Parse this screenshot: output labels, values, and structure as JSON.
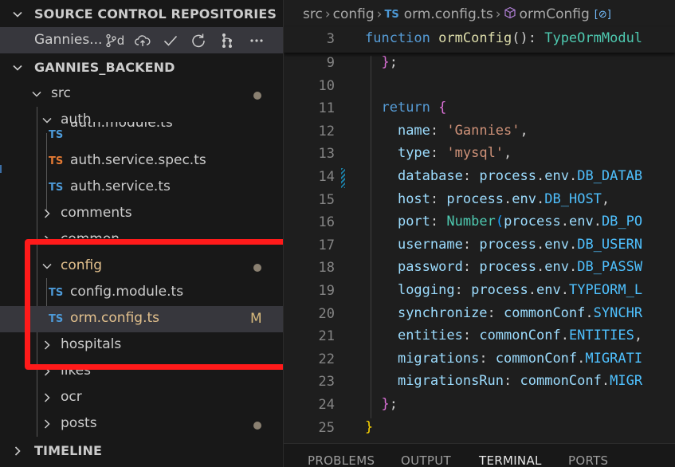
{
  "sidebar": {
    "source_control_header": "SOURCE CONTROL REPOSITORIES",
    "repo": {
      "name": "Gannies...",
      "branch_label": "d",
      "icons": [
        "git-branch-icon",
        "cloud-upload-icon",
        "check-icon",
        "refresh-icon",
        "graph-icon",
        "more-icon"
      ]
    },
    "explorer_header": "GANNIES_BACKEND",
    "tree": [
      {
        "label": "src",
        "kind": "folder",
        "expanded": true,
        "modified_dot": true
      },
      {
        "label": "auth",
        "kind": "folder",
        "expanded": true
      },
      {
        "label": "auth.module.ts",
        "kind": "file",
        "ts_color": "#4d9ad8"
      },
      {
        "label": "auth.service.spec.ts",
        "kind": "file",
        "ts_color": "#e37933"
      },
      {
        "label": "auth.service.ts",
        "kind": "file",
        "ts_color": "#4d9ad8"
      },
      {
        "label": "comments",
        "kind": "folder",
        "expanded": false
      },
      {
        "label": "common",
        "kind": "folder",
        "expanded": false
      },
      {
        "label": "config",
        "kind": "folder",
        "expanded": true,
        "modified_dot": true,
        "color": "#e2c08d"
      },
      {
        "label": "config.module.ts",
        "kind": "file",
        "ts_color": "#4d9ad8"
      },
      {
        "label": "orm.config.ts",
        "kind": "file",
        "ts_color": "#4d9ad8",
        "badge": "M",
        "selected": true,
        "color": "#e2c08d"
      },
      {
        "label": "hospitals",
        "kind": "folder",
        "expanded": false
      },
      {
        "label": "likes",
        "kind": "folder",
        "expanded": false
      },
      {
        "label": "ocr",
        "kind": "folder",
        "expanded": false
      },
      {
        "label": "posts",
        "kind": "folder",
        "expanded": false,
        "modified_dot": true
      }
    ],
    "ts_label": "TS",
    "timeline_header": "TIMELINE",
    "highlight_color": "#ff1a1a"
  },
  "editor": {
    "breadcrumb": {
      "segments": [
        "src",
        "config",
        "orm.config.ts",
        "ormConfig"
      ],
      "ts_label": "TS"
    },
    "sticky_line": {
      "number": "3",
      "kw": "function",
      "fn": "ormConfig",
      "after": "(): ",
      "type": "TypeOrmModul"
    },
    "lines": [
      {
        "n": "9",
        "tokens": [
          [
            "pu",
            "  "
          ],
          [
            "br2",
            "}"
          ],
          [
            "pu",
            ";"
          ]
        ]
      },
      {
        "n": "10",
        "tokens": []
      },
      {
        "n": "11",
        "tokens": [
          [
            "pu",
            "  "
          ],
          [
            "kw",
            "return"
          ],
          [
            "pu",
            " "
          ],
          [
            "br2",
            "{"
          ]
        ]
      },
      {
        "n": "12",
        "tokens": [
          [
            "pu",
            "    "
          ],
          [
            "pr",
            "name"
          ],
          [
            "pu",
            ": "
          ],
          [
            "st",
            "'Gannies'"
          ],
          [
            "pu",
            ","
          ]
        ]
      },
      {
        "n": "13",
        "tokens": [
          [
            "pu",
            "    "
          ],
          [
            "pr",
            "type"
          ],
          [
            "pu",
            ": "
          ],
          [
            "st",
            "'mysql'"
          ],
          [
            "pu",
            ","
          ]
        ]
      },
      {
        "n": "14",
        "tokens": [
          [
            "pu",
            "    "
          ],
          [
            "pr",
            "database"
          ],
          [
            "pu",
            ": "
          ],
          [
            "pr",
            "process"
          ],
          [
            "pu",
            "."
          ],
          [
            "pr",
            "env"
          ],
          [
            "pu",
            "."
          ],
          [
            "cn",
            "DB_DATAB"
          ]
        ]
      },
      {
        "n": "15",
        "tokens": [
          [
            "pu",
            "    "
          ],
          [
            "pr",
            "host"
          ],
          [
            "pu",
            ": "
          ],
          [
            "pr",
            "process"
          ],
          [
            "pu",
            "."
          ],
          [
            "pr",
            "env"
          ],
          [
            "pu",
            "."
          ],
          [
            "cn",
            "DB_HOST"
          ],
          [
            "pu",
            ","
          ]
        ]
      },
      {
        "n": "16",
        "tokens": [
          [
            "pu",
            "    "
          ],
          [
            "pr",
            "port"
          ],
          [
            "pu",
            ": "
          ],
          [
            "ty",
            "Number"
          ],
          [
            "br3",
            "("
          ],
          [
            "pr",
            "process"
          ],
          [
            "pu",
            "."
          ],
          [
            "pr",
            "env"
          ],
          [
            "pu",
            "."
          ],
          [
            "cn",
            "DB_PO"
          ]
        ]
      },
      {
        "n": "17",
        "tokens": [
          [
            "pu",
            "    "
          ],
          [
            "pr",
            "username"
          ],
          [
            "pu",
            ": "
          ],
          [
            "pr",
            "process"
          ],
          [
            "pu",
            "."
          ],
          [
            "pr",
            "env"
          ],
          [
            "pu",
            "."
          ],
          [
            "cn",
            "DB_USERN"
          ]
        ]
      },
      {
        "n": "18",
        "tokens": [
          [
            "pu",
            "    "
          ],
          [
            "pr",
            "password"
          ],
          [
            "pu",
            ": "
          ],
          [
            "pr",
            "process"
          ],
          [
            "pu",
            "."
          ],
          [
            "pr",
            "env"
          ],
          [
            "pu",
            "."
          ],
          [
            "cn",
            "DB_PASSW"
          ]
        ]
      },
      {
        "n": "19",
        "tokens": [
          [
            "pu",
            "    "
          ],
          [
            "pr",
            "logging"
          ],
          [
            "pu",
            ": "
          ],
          [
            "pr",
            "process"
          ],
          [
            "pu",
            "."
          ],
          [
            "pr",
            "env"
          ],
          [
            "pu",
            "."
          ],
          [
            "cn",
            "TYPEORM_L"
          ]
        ]
      },
      {
        "n": "20",
        "tokens": [
          [
            "pu",
            "    "
          ],
          [
            "pr",
            "synchronize"
          ],
          [
            "pu",
            ": "
          ],
          [
            "pr",
            "commonConf"
          ],
          [
            "pu",
            "."
          ],
          [
            "cn",
            "SYNCHR"
          ]
        ]
      },
      {
        "n": "21",
        "tokens": [
          [
            "pu",
            "    "
          ],
          [
            "pr",
            "entities"
          ],
          [
            "pu",
            ": "
          ],
          [
            "pr",
            "commonConf"
          ],
          [
            "pu",
            "."
          ],
          [
            "cn",
            "ENTITIES"
          ],
          [
            "pu",
            ","
          ]
        ]
      },
      {
        "n": "22",
        "tokens": [
          [
            "pu",
            "    "
          ],
          [
            "pr",
            "migrations"
          ],
          [
            "pu",
            ": "
          ],
          [
            "pr",
            "commonConf"
          ],
          [
            "pu",
            "."
          ],
          [
            "cn",
            "MIGRATI"
          ]
        ]
      },
      {
        "n": "23",
        "tokens": [
          [
            "pu",
            "    "
          ],
          [
            "pr",
            "migrationsRun"
          ],
          [
            "pu",
            ": "
          ],
          [
            "pr",
            "commonConf"
          ],
          [
            "pu",
            "."
          ],
          [
            "cn",
            "MIGR"
          ]
        ]
      },
      {
        "n": "24",
        "tokens": [
          [
            "pu",
            "  "
          ],
          [
            "br2",
            "}"
          ],
          [
            "pu",
            ";"
          ]
        ]
      },
      {
        "n": "25",
        "tokens": [
          [
            "br1",
            "}"
          ]
        ]
      }
    ]
  },
  "panel": {
    "tabs": [
      {
        "label": "PROBLEMS",
        "active": false
      },
      {
        "label": "OUTPUT",
        "active": false
      },
      {
        "label": "TERMINAL",
        "active": true
      },
      {
        "label": "PORTS",
        "active": false
      }
    ]
  }
}
